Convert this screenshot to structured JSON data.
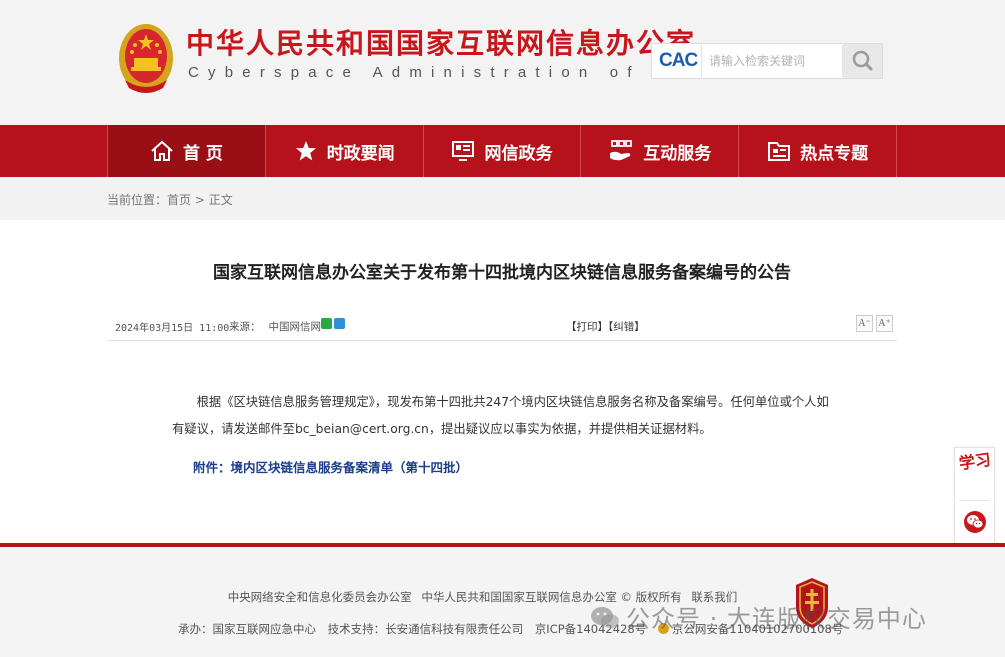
{
  "header": {
    "title": "中华人民共和国国家互联网信息办公室",
    "subtitle": "Cyberspace Administration of China",
    "logo_text": "CAC",
    "search_placeholder": "请输入检索关键词"
  },
  "nav": {
    "items": [
      {
        "label": "首 页",
        "icon": "home-icon"
      },
      {
        "label": "时政要闻",
        "icon": "star-icon"
      },
      {
        "label": "网信政务",
        "icon": "monitor-icon"
      },
      {
        "label": "互动服务",
        "icon": "hand-icon"
      },
      {
        "label": "热点专题",
        "icon": "folder-icon"
      }
    ]
  },
  "breadcrumb": {
    "prefix": "当前位置：",
    "home": "首页",
    "sep": " > ",
    "current": "正文"
  },
  "article": {
    "title": "国家互联网信息办公室关于发布第十四批境内区块链信息服务备案编号的公告",
    "date": "2024年03月15日 11:00",
    "source_label": "来源：",
    "source": "中国网信网",
    "print": "【打印】",
    "correct": "【纠错】",
    "font_smaller": "A⁻",
    "font_larger": "A⁺",
    "body": "根据《区块链信息服务管理规定》，现发布第十四批共247个境内区块链信息服务名称及备案编号。任何单位或个人如有疑议，请发送邮件至bc_beian@cert.org.cn，提出疑议应以事实为依据，并提供相关证据材料。",
    "attachment": "附件：境内区块链信息服务备案清单（第十四批）"
  },
  "side": {
    "xuexi": "学习"
  },
  "footer": {
    "line1": [
      "中央网络安全和信息化委员会办公室",
      "中华人民共和国国家互联网信息办公室 © 版权所有",
      "联系我们"
    ],
    "line2": [
      "承办：国家互联网应急中心",
      "技术支持：长安通信科技有限责任公司",
      "京ICP备14042428号"
    ],
    "police": "京公网安备11040102700108号",
    "watermark": "公众号 · 大连版权交易中心"
  },
  "colors": {
    "brand_red": "#b5121b",
    "title_red": "#c8161d",
    "link_blue": "#1b3e8c"
  }
}
